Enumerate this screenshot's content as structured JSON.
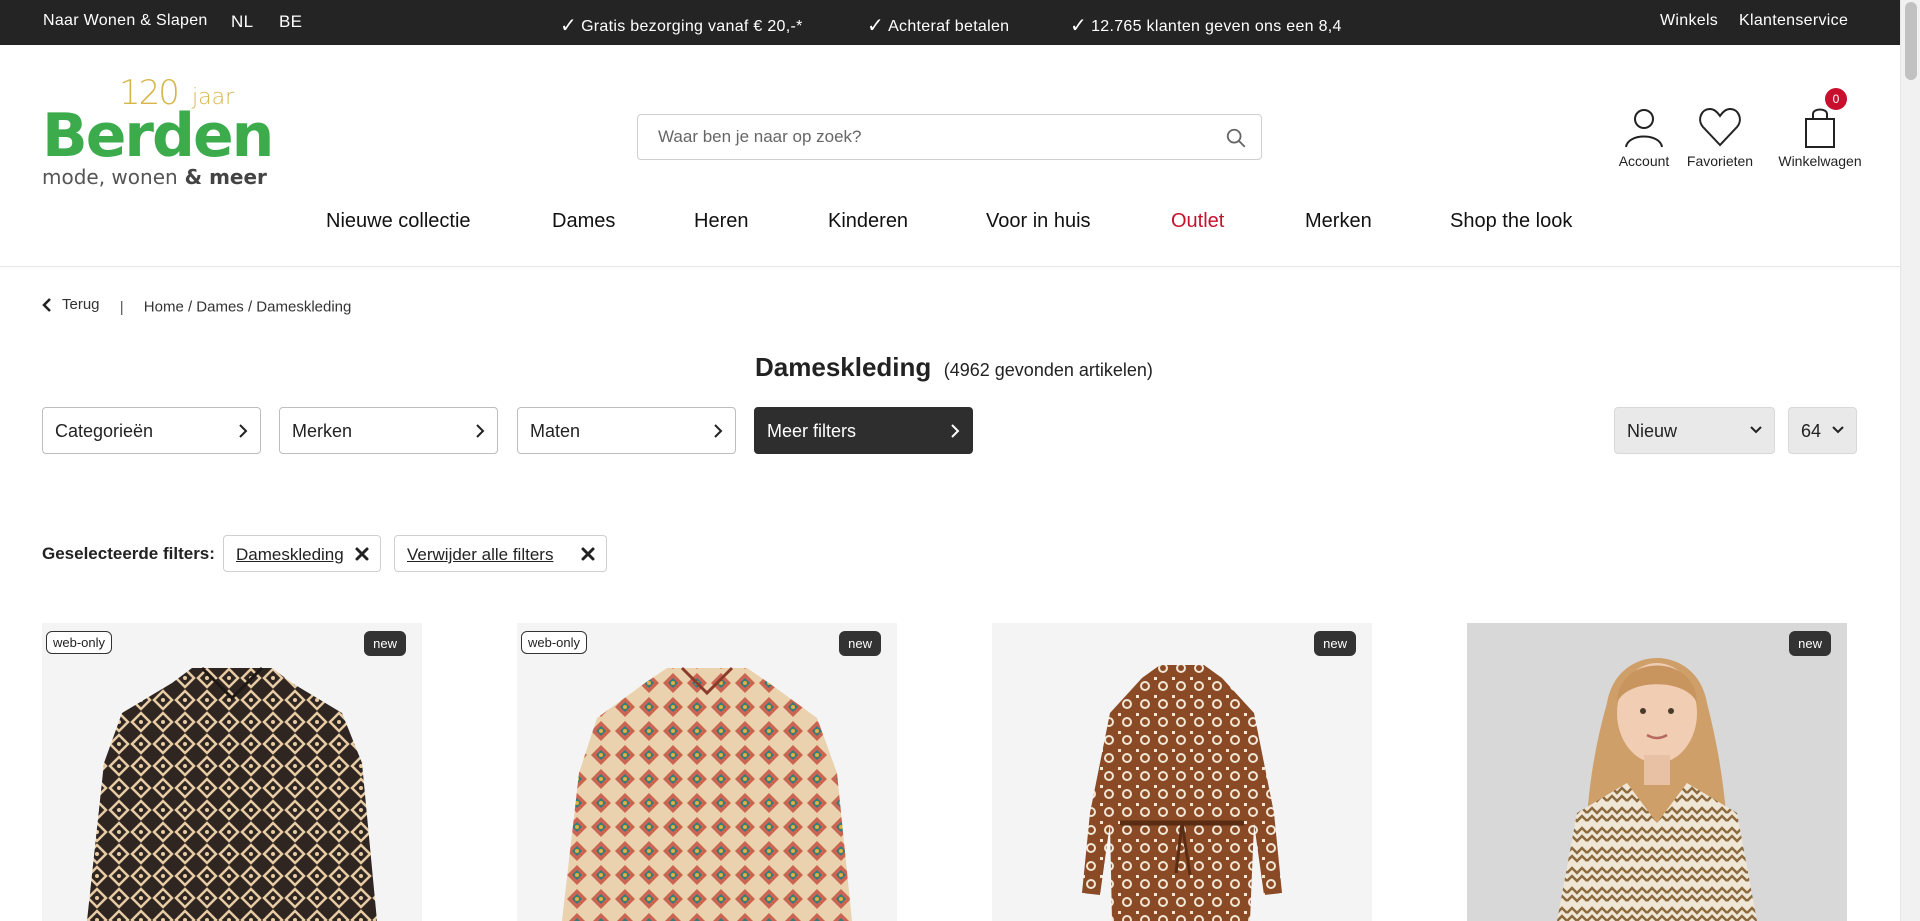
{
  "topbar": {
    "link_wonen": "Naar Wonen & Slapen",
    "lang_nl": "NL",
    "lang_be": "BE",
    "usp1": "Gratis bezorging vanaf € 20,-*",
    "usp2": "Achteraf betalen",
    "usp3": "12.765 klanten geven ons een 8,4",
    "link_stores": "Winkels",
    "link_service": "Klantenservice"
  },
  "logo": {
    "years": "120",
    "jaar": "jaar",
    "brand": "Berden",
    "tagline_a": "mode, wonen",
    "tagline_amp": " & ",
    "tagline_b": "meer"
  },
  "search": {
    "placeholder": "Waar ben je naar op zoek?"
  },
  "header_icons": {
    "account": "Account",
    "favorites": "Favorieten",
    "cart": "Winkelwagen",
    "cart_count": "0"
  },
  "nav": [
    "Nieuwe collectie",
    "Dames",
    "Heren",
    "Kinderen",
    "Voor in huis",
    "Outlet",
    "Merken",
    "Shop the look"
  ],
  "breadcrumb": {
    "back": "Terug",
    "sep": "|",
    "path": "Home / Dames / Dameskleding"
  },
  "page": {
    "title": "Dameskleding",
    "count": "(4962 gevonden artikelen)"
  },
  "filters": {
    "categories": "Categorieën",
    "brands": "Merken",
    "sizes": "Maten",
    "more": "Meer filters",
    "sort": "Nieuw",
    "per_page": "64"
  },
  "selected_filters": {
    "heading": "Geselecteerde filters:",
    "chip1": "Dameskleding",
    "chip2": "Verwijder alle filters"
  },
  "products": [
    {
      "badge_left": "web-only",
      "badge_right": "new"
    },
    {
      "badge_left": "web-only",
      "badge_right": "new"
    },
    {
      "badge_right": "new"
    },
    {
      "badge_right": "new"
    }
  ],
  "colors": {
    "topbar": "#242424",
    "brand_green": "#3cab4c",
    "gold": "#d8b54a",
    "outlet_red": "#c8102e",
    "dark_button": "#2e2e2e"
  }
}
